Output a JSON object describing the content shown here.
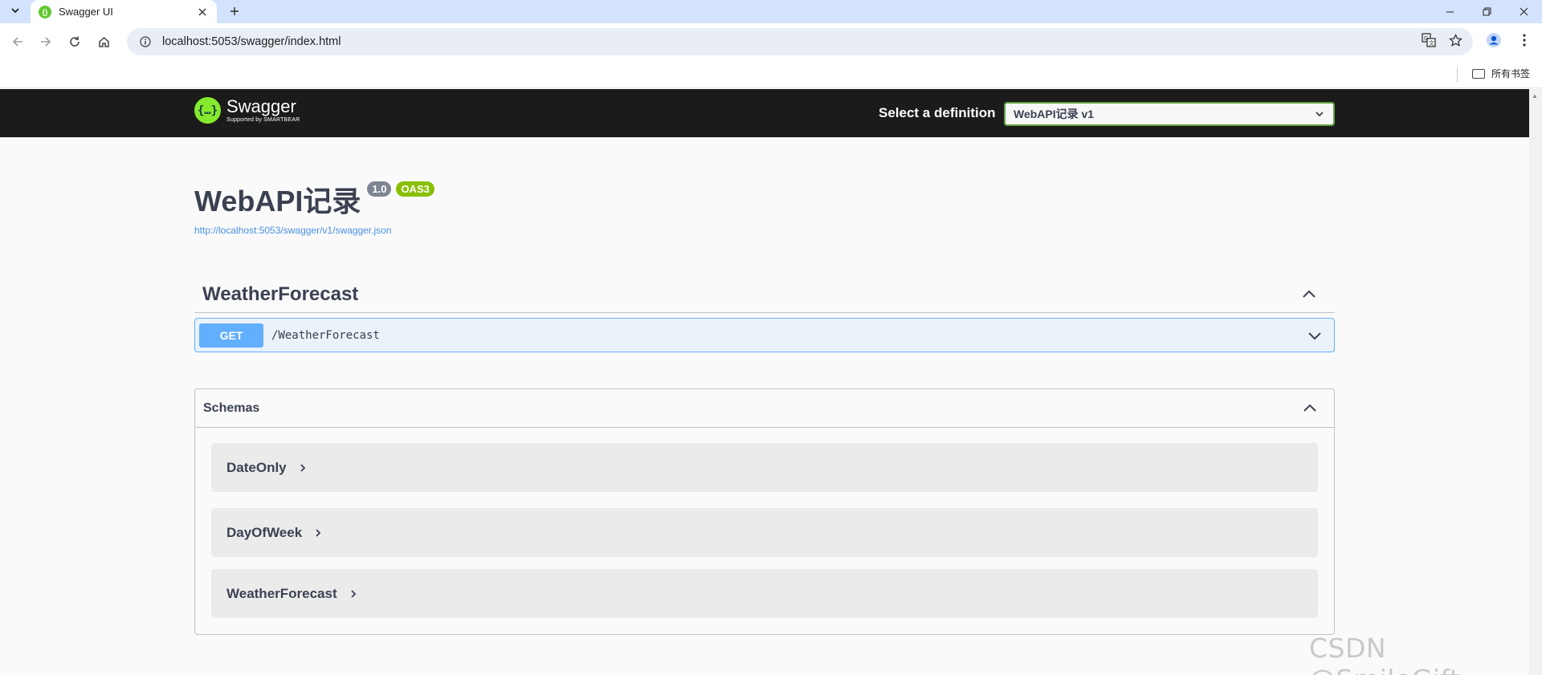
{
  "browser": {
    "tab_title": "Swagger UI",
    "url": "localhost:5053/swagger/index.html",
    "bookmarks_label": "所有书签"
  },
  "swagger": {
    "logo_name": "Swagger",
    "logo_sub": "Supported by SMARTBEAR",
    "definition_label": "Select a definition",
    "definition_selected": "WebAPI记录 v1"
  },
  "info": {
    "title": "WebAPI记录",
    "version": "1.0",
    "oas": "OAS3",
    "spec_url": "http://localhost:5053/swagger/v1/swagger.json"
  },
  "tags": [
    {
      "name": "WeatherForecast",
      "operations": [
        {
          "method": "GET",
          "path": "/WeatherForecast"
        }
      ]
    }
  ],
  "schemas": {
    "title": "Schemas",
    "items": [
      "DateOnly",
      "DayOfWeek",
      "WeatherForecast"
    ]
  },
  "watermark": "CSDN @SmileGift",
  "colors": {
    "get_method": "#61affe",
    "topbar": "#1b1b1b",
    "logo_green": "#85ea2d",
    "oas_badge": "#89bf04",
    "version_badge": "#7d8492"
  }
}
